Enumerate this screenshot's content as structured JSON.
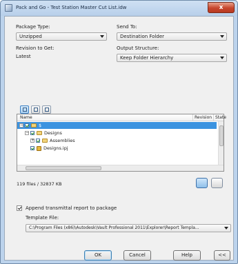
{
  "window": {
    "title": "Pack and Go - Test Station Master Cut List.idw",
    "close_glyph": "x"
  },
  "package_type": {
    "label": "Package Type:",
    "value": "Unzipped"
  },
  "send_to": {
    "label": "Send To:",
    "value": "Destination Folder"
  },
  "revision": {
    "label": "Revision to Get:",
    "value": "Latest"
  },
  "output_structure": {
    "label": "Output Structure:",
    "value": "Keep Folder Hierarchy"
  },
  "file_list": {
    "columns": [
      "Name",
      "Revision",
      "State"
    ],
    "rows": [
      {
        "name": "$",
        "level": 0,
        "expander": "−",
        "icon": "folder-icon",
        "selected": true
      },
      {
        "name": "Designs",
        "level": 1,
        "expander": "−",
        "icon": "folder-icon",
        "selected": false
      },
      {
        "name": "Assemblies",
        "level": 2,
        "expander": "+",
        "icon": "folder-icon",
        "selected": false
      },
      {
        "name": "Designs.ipj",
        "level": 1,
        "expander": "",
        "icon": "project-file-icon",
        "selected": false
      }
    ]
  },
  "summary": {
    "file_count": "119 files / 32837 KB"
  },
  "transmittal": {
    "label": "Append transmittal report to package",
    "checked": true
  },
  "template": {
    "label": "Template File:",
    "value": "C:\\Program Files (x86)\\Autodesk\\Vault Professional 2011\\Explorer\\Report Templa..."
  },
  "buttons": {
    "ok": "OK",
    "cancel": "Cancel",
    "help": "Help",
    "more": "<<"
  },
  "colors": {
    "selection": "#3b93e0",
    "titlebar": "#bcd3ec",
    "close": "#c7452c"
  }
}
